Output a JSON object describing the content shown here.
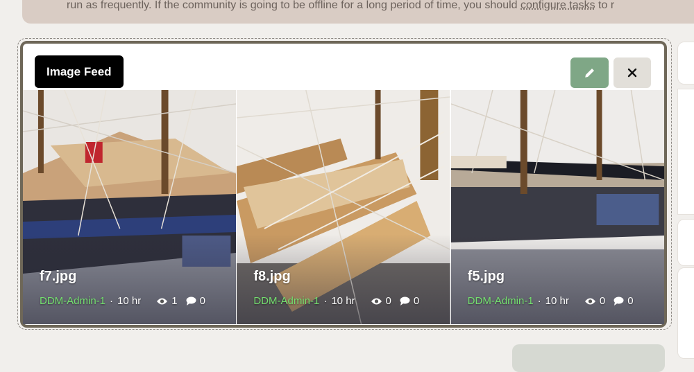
{
  "notice": {
    "text_before": "run as frequently. If the community is going to be offline for a long period of time, you should ",
    "link": "configure tasks",
    "text_after": " to r"
  },
  "widget": {
    "title": "Image Feed",
    "edit_icon": "pencil-icon",
    "close_icon": "close-icon",
    "colors": {
      "edit_bg": "#7fa786",
      "author": "#74e06f",
      "frame": "#6e6758"
    }
  },
  "images": [
    {
      "name": "f7.jpg",
      "author": "DDM-Admin-1",
      "time": "10 hr",
      "views": "1",
      "comments": "0"
    },
    {
      "name": "f8.jpg",
      "author": "DDM-Admin-1",
      "time": "10 hr",
      "views": "0",
      "comments": "0"
    },
    {
      "name": "f5.jpg",
      "author": "DDM-Admin-1",
      "time": "10 hr",
      "views": "0",
      "comments": "0"
    }
  ]
}
